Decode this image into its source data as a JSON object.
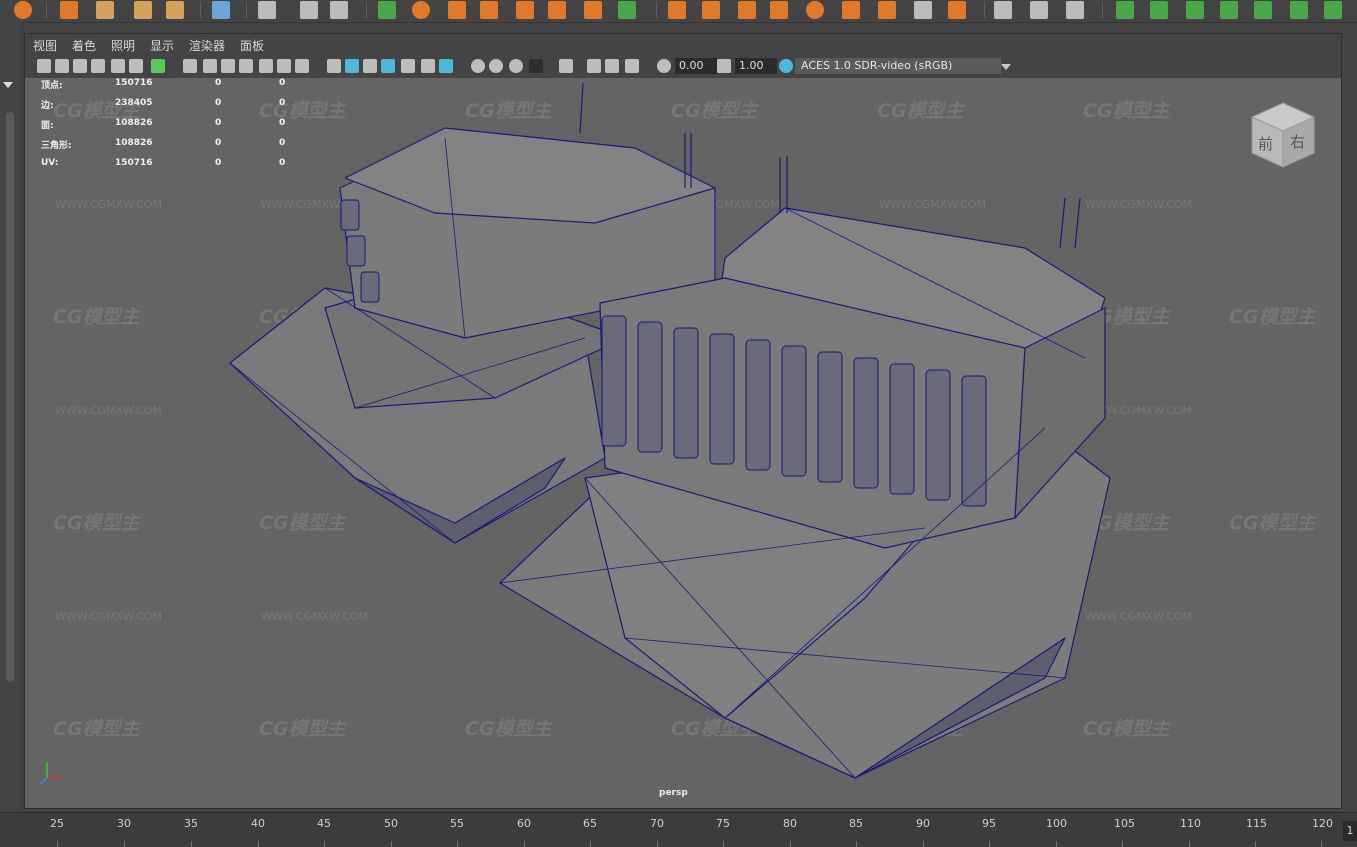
{
  "menubar": {
    "items": [
      "视图",
      "着色",
      "照明",
      "显示",
      "渲染器",
      "面板"
    ]
  },
  "toolbar": {
    "gamma_value": "0.00",
    "exposure_value": "1.00",
    "color_management": "ACES 1.0 SDR-video (sRGB)"
  },
  "heads_up": {
    "rows": [
      {
        "label": "顶点:",
        "v1": "150716",
        "v2": "0",
        "v3": "0"
      },
      {
        "label": "边:",
        "v1": "238405",
        "v2": "0",
        "v3": "0"
      },
      {
        "label": "面:",
        "v1": "108826",
        "v2": "0",
        "v3": "0"
      },
      {
        "label": "三角形:",
        "v1": "108826",
        "v2": "0",
        "v3": "0"
      },
      {
        "label": "UV:",
        "v1": "150716",
        "v2": "0",
        "v3": "0"
      }
    ]
  },
  "viewport": {
    "camera_label": "persp",
    "watermark_logo": "CG模型主",
    "watermark_url": "WWW.CGMXW.COM"
  },
  "viewcube": {
    "face_front": "前",
    "face_right": "右"
  },
  "time_ruler": {
    "ticks": [
      "25",
      "30",
      "35",
      "40",
      "45",
      "50",
      "55",
      "60",
      "65",
      "70",
      "75",
      "80",
      "85",
      "90",
      "95",
      "100",
      "105",
      "110",
      "115",
      "120"
    ],
    "current_frame": "1"
  },
  "colors": {
    "wireframe": "#1a1a7a",
    "viewport_bg": "#646464",
    "accent_cyan": "#4fb8d8"
  }
}
